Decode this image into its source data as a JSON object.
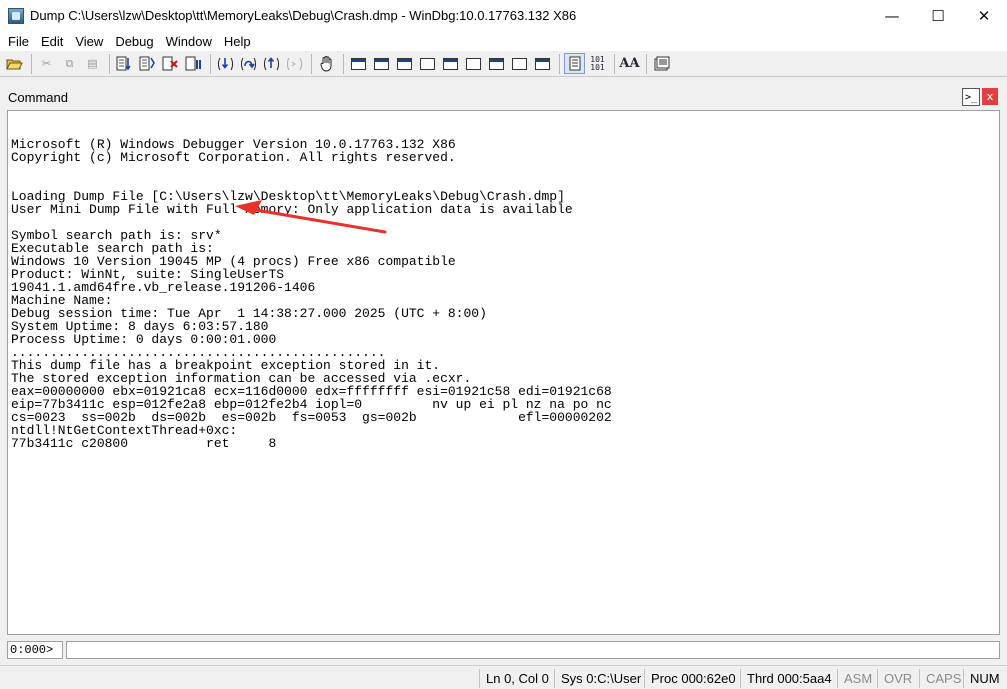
{
  "window": {
    "title": "Dump C:\\Users\\lzw\\Desktop\\tt\\MemoryLeaks\\Debug\\Crash.dmp - WinDbg:10.0.17763.132 X86",
    "minimize_glyph": "—",
    "maximize_glyph": "☐",
    "close_glyph": "✕"
  },
  "menu": {
    "items": [
      {
        "label": "File"
      },
      {
        "label": "Edit"
      },
      {
        "label": "View"
      },
      {
        "label": "Debug"
      },
      {
        "label": "Window"
      },
      {
        "label": "Help"
      }
    ]
  },
  "toolbar": {
    "icons": [
      "open-icon",
      "cut-icon",
      "copy-icon",
      "paste-icon",
      "go-icon",
      "restart-icon",
      "stop-debugging-icon",
      "break-icon",
      "step-into-icon",
      "step-over-icon",
      "step-out-icon",
      "run-to-cursor-icon",
      "hand-icon",
      "command-window-icon",
      "watch-window-icon",
      "locals-window-icon",
      "registers-window-icon",
      "memory-window-icon",
      "call-stack-icon",
      "disassembly-window-icon",
      "scratch-pad-icon",
      "processes-threads-icon",
      "source-mode-icon",
      "hex-mode-icon",
      "font-icon",
      "options-icon"
    ],
    "hex_label": "101\n101",
    "font_label": "AA"
  },
  "command_pane": {
    "title": "Command",
    "console_glyph": ">_",
    "close_glyph": "x",
    "output": [
      "",
      "Microsoft (R) Windows Debugger Version 10.0.17763.132 X86",
      "Copyright (c) Microsoft Corporation. All rights reserved.",
      "",
      "",
      "Loading Dump File [C:\\Users\\lzw\\Desktop\\tt\\MemoryLeaks\\Debug\\Crash.dmp]",
      "User Mini Dump File with Full Memory: Only application data is available",
      "",
      "Symbol search path is: srv*",
      "Executable search path is: ",
      "Windows 10 Version 19045 MP (4 procs) Free x86 compatible",
      "Product: WinNt, suite: SingleUserTS",
      "19041.1.amd64fre.vb_release.191206-1406",
      "Machine Name:",
      "Debug session time: Tue Apr  1 14:38:27.000 2025 (UTC + 8:00)",
      "System Uptime: 8 days 6:03:57.180",
      "Process Uptime: 0 days 0:00:01.000",
      "................................................",
      "This dump file has a breakpoint exception stored in it.",
      "The stored exception information can be accessed via .ecxr.",
      "eax=00000000 ebx=01921ca8 ecx=116d0000 edx=ffffffff esi=01921c58 edi=01921c68",
      "eip=77b3411c esp=012fe2a8 ebp=012fe2b4 iopl=0         nv up ei pl nz na po nc",
      "cs=0023  ss=002b  ds=002b  es=002b  fs=0053  gs=002b             efl=00000202",
      "ntdll!NtGetContextThread+0xc:",
      "77b3411c c20800          ret     8"
    ],
    "prompt": "0:000>",
    "input_value": ""
  },
  "status_bar": {
    "position": "Ln 0, Col 0",
    "sys": "Sys 0:C:\\User",
    "proc": "Proc 000:62e0",
    "thrd": "Thrd 000:5aa4",
    "asm": "ASM",
    "ovr": "OVR",
    "caps": "CAPS",
    "num": "NUM"
  },
  "colors": {
    "annotation_arrow": "#e8312b",
    "pane_close": "#e04040"
  }
}
